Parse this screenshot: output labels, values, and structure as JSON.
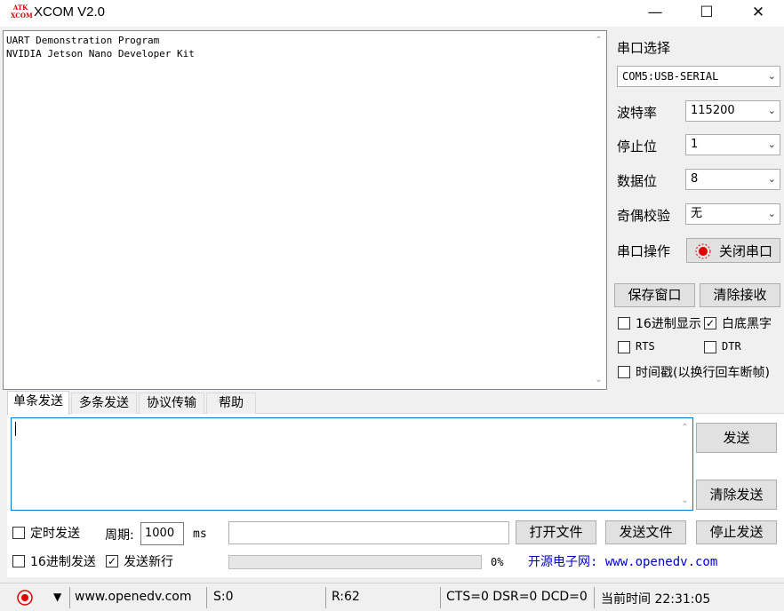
{
  "window": {
    "logo_top": "ATK",
    "logo_bottom": "XCOM",
    "title": "XCOM V2.0",
    "minimize": "—",
    "maximize": "☐",
    "close": "✕"
  },
  "receive": {
    "lines": "UART Demonstration Program\nNVIDIA Jetson Nano Developer Kit"
  },
  "serial": {
    "port_label": "串口选择",
    "port_value": "COM5:USB-SERIAL",
    "baud_label": "波特率",
    "baud_value": "115200",
    "stop_label": "停止位",
    "stop_value": "1",
    "data_label": "数据位",
    "data_value": "8",
    "parity_label": "奇偶校验",
    "parity_value": "无",
    "op_label": "串口操作",
    "op_button": "关闭串口"
  },
  "recv_controls": {
    "save_window": "保存窗口",
    "clear_receive": "清除接收",
    "hex_display": "16进制显示",
    "white_bg": "白底黑字",
    "rts": "RTS",
    "dtr": "DTR",
    "timestamp": "时间戳(以换行回车断帧)"
  },
  "tabs": [
    "单条发送",
    "多条发送",
    "协议传输",
    "帮助"
  ],
  "send": {
    "send_button": "发送",
    "clear_send": "清除发送",
    "timed_send": "定时发送",
    "period_label": "周期:",
    "period_value": "1000",
    "period_unit": "ms",
    "open_file": "打开文件",
    "send_file": "发送文件",
    "stop_send": "停止发送",
    "hex_send": "16进制发送",
    "send_newline": "发送新行",
    "progress": "0%",
    "site_banner": "开源电子网: www.openedv.com"
  },
  "status": {
    "url": "www.openedv.com",
    "sent": "S:0",
    "received": "R:62",
    "lines": "CTS=0 DSR=0 DCD=0",
    "time": "当前时间 22:31:05"
  },
  "colors": {
    "accent": "#0078d7",
    "record_red": "#e00000",
    "banner_blue": "#0000cc"
  }
}
